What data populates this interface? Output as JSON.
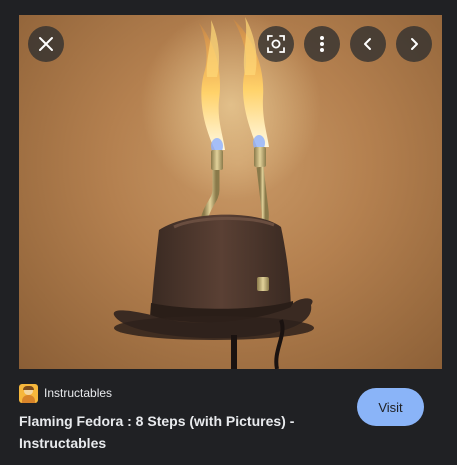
{
  "image": {
    "alt_subject": "Flaming fedora hat with two torches"
  },
  "controls": {
    "close_icon": "close-icon",
    "lens_icon": "lens-search-icon",
    "more_icon": "more-vert-icon",
    "prev_icon": "chevron-left-icon",
    "next_icon": "chevron-right-icon"
  },
  "result": {
    "source_name": "Instructables",
    "title": "Flaming Fedora : 8 Steps (with Pictures) - Instructables",
    "visit_label": "Visit"
  },
  "colors": {
    "background": "#202124",
    "visit_button": "#8ab4f8",
    "text": "#e8eaed"
  }
}
